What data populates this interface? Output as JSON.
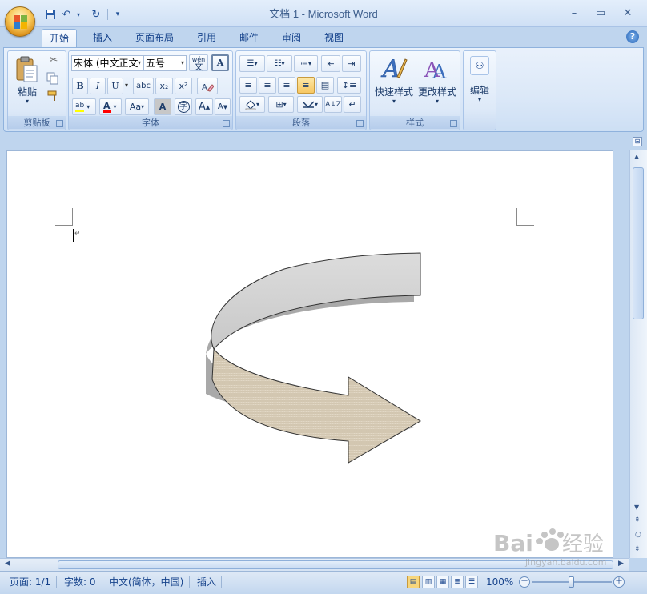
{
  "window": {
    "title": "文档 1 - Microsoft Word"
  },
  "quick_access": {
    "icons": [
      "save-icon",
      "undo-icon",
      "redo-icon",
      "customize-icon"
    ]
  },
  "tabs": [
    {
      "label": "开始",
      "active": true
    },
    {
      "label": "插入"
    },
    {
      "label": "页面布局"
    },
    {
      "label": "引用"
    },
    {
      "label": "邮件"
    },
    {
      "label": "审阅"
    },
    {
      "label": "视图"
    }
  ],
  "ribbon": {
    "clipboard": {
      "label": "剪贴板",
      "paste": "粘贴"
    },
    "font": {
      "label": "字体",
      "font_name": "宋体 (中文正文",
      "font_size": "五号",
      "bold": "B",
      "italic": "I",
      "underline": "U",
      "strike": "abc",
      "subscript": "x₂",
      "superscript": "x²",
      "grow": "A",
      "shrink": "A",
      "case": "Aa",
      "char_border": "A",
      "enclose": "字",
      "phonetic": "wén",
      "phonetic_char": "文"
    },
    "paragraph": {
      "label": "段落"
    },
    "styles": {
      "label": "样式",
      "quick_styles": "快速样式",
      "change_styles": "更改样式"
    },
    "editing": {
      "label": "编辑"
    }
  },
  "statusbar": {
    "page": "页面: 1/1",
    "words": "字数: 0",
    "language": "中文(简体，中国)",
    "mode": "插入",
    "zoom": "100%",
    "zoom_out": "－",
    "zoom_in": "＋"
  },
  "colors": {
    "highlight": "#ffff00",
    "font_color": "#ff0000",
    "arrow_fill": "#e0d6c4",
    "arrow_top": "#d4d4d4"
  }
}
